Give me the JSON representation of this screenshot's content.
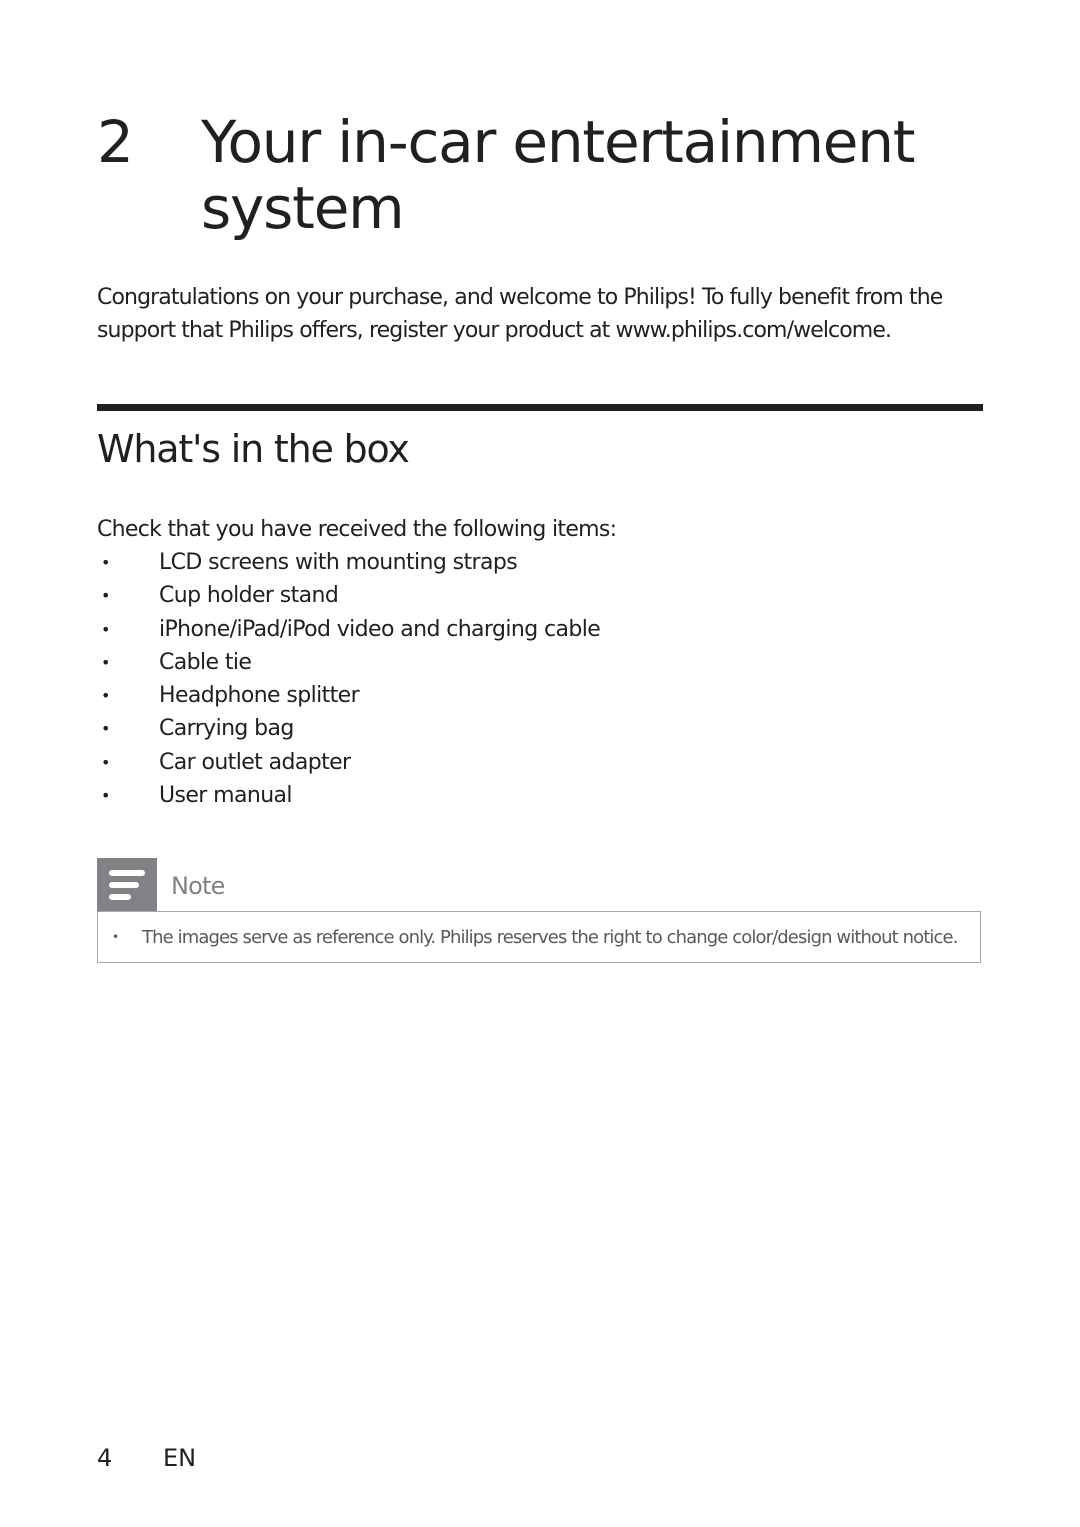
{
  "chapter": {
    "number": "2",
    "title": "Your in-car entertainment system"
  },
  "intro": "Congratulations on your purchase, and welcome to Philips! To fully benefit from the support that Philips offers, register your product at www.philips.com/welcome.",
  "section": {
    "title": "What's in the box",
    "lead": "Check that you have received the following items:",
    "bullet_glyph": "•",
    "items": [
      "LCD screens with mounting straps",
      "Cup holder stand",
      "iPhone/iPad/iPod video and charging cable",
      "Cable tie",
      "Headphone splitter",
      "Carrying bag",
      "Car outlet adapter",
      "User manual"
    ]
  },
  "note": {
    "icon": "note-lines-icon",
    "label": "Note",
    "bullet_glyph": "•",
    "text": "The images serve as reference only. Philips reserves the right to change color/design without notice."
  },
  "footer": {
    "page_number": "4",
    "language": "EN"
  }
}
